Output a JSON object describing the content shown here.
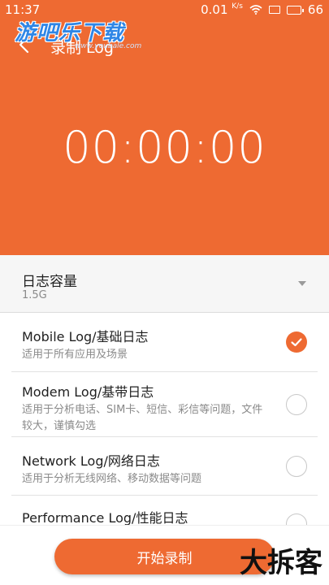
{
  "status_bar": {
    "time": "11:37",
    "speed": "0.01",
    "speed_unit": "K/s",
    "battery": "66"
  },
  "watermark": {
    "text": "游吧乐下载",
    "sub": "www.youbale.com"
  },
  "header": {
    "title": "录制 Log"
  },
  "timer": {
    "value": "00:00:00"
  },
  "capacity": {
    "label": "日志容量",
    "value": "1.5G"
  },
  "logs": [
    {
      "title": "Mobile Log/基础日志",
      "desc": "适用于所有应用及场景",
      "checked": true
    },
    {
      "title": "Modem Log/基带日志",
      "desc": "适用于分析电话、SIM卡、短信、彩信等问题，文件较大，谨慎勾选",
      "checked": false
    },
    {
      "title": "Network Log/网络日志",
      "desc": "适用于分析无线网络、移动数据等问题",
      "checked": false
    },
    {
      "title": "Performance Log/性能日志",
      "desc": "",
      "checked": false
    }
  ],
  "bottom": {
    "start_label": "开始录制",
    "corner_watermark": "大拆客"
  },
  "colors": {
    "accent": "#ee6a32"
  }
}
